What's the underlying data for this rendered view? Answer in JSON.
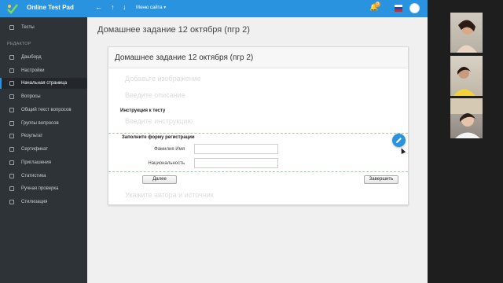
{
  "topbar": {
    "brand": "Online Test Pad",
    "menu_label": "Меню сайта",
    "notif_count": "8",
    "accent_color": "#2a93e0",
    "icons": [
      "logo-icon",
      "back-arrow-icon",
      "up-arrow-icon",
      "down-arrow-icon",
      "dropdown-caret-icon",
      "bell-icon",
      "flag-icon",
      "avatar-icon"
    ]
  },
  "sidebar": {
    "top_item": "Тесты",
    "section": "РЕДАКТОР",
    "items": [
      {
        "label": "Дашборд",
        "icon": "dashboard-icon"
      },
      {
        "label": "Настройки",
        "icon": "settings-icon"
      },
      {
        "label": "Начальная страница",
        "icon": "page-icon",
        "active": true
      },
      {
        "label": "Вопросы",
        "icon": "questions-icon"
      },
      {
        "label": "Общий текст вопросов",
        "icon": "text-icon"
      },
      {
        "label": "Группы вопросов",
        "icon": "groups-icon"
      },
      {
        "label": "Результат",
        "icon": "result-icon"
      },
      {
        "label": "Сертификат",
        "icon": "certificate-icon"
      },
      {
        "label": "Приглашения",
        "icon": "invite-icon"
      },
      {
        "label": "Статистика",
        "icon": "stats-icon"
      },
      {
        "label": "Ручная проверка",
        "icon": "check-icon"
      },
      {
        "label": "Стилизация",
        "icon": "style-icon"
      }
    ]
  },
  "main": {
    "page_title": "Домашнее задание 12 октября (пгр 2)",
    "card_title": "Домашнее задание 12 октября (пгр 2)",
    "add_image_placeholder": "Добавьте изображение",
    "description_placeholder": "Введите описание",
    "instruction_label": "Инструкция к тесту",
    "instruction_placeholder": "Введите инструкцию",
    "registration_label": "Заполните форму регистрации",
    "fields": [
      {
        "label": "Фамилия Имя",
        "value": ""
      },
      {
        "label": "Национальность",
        "value": ""
      }
    ],
    "next_button": "Далее",
    "finish_button": "Завершить",
    "author_placeholder": "Укажите автора и источник"
  }
}
